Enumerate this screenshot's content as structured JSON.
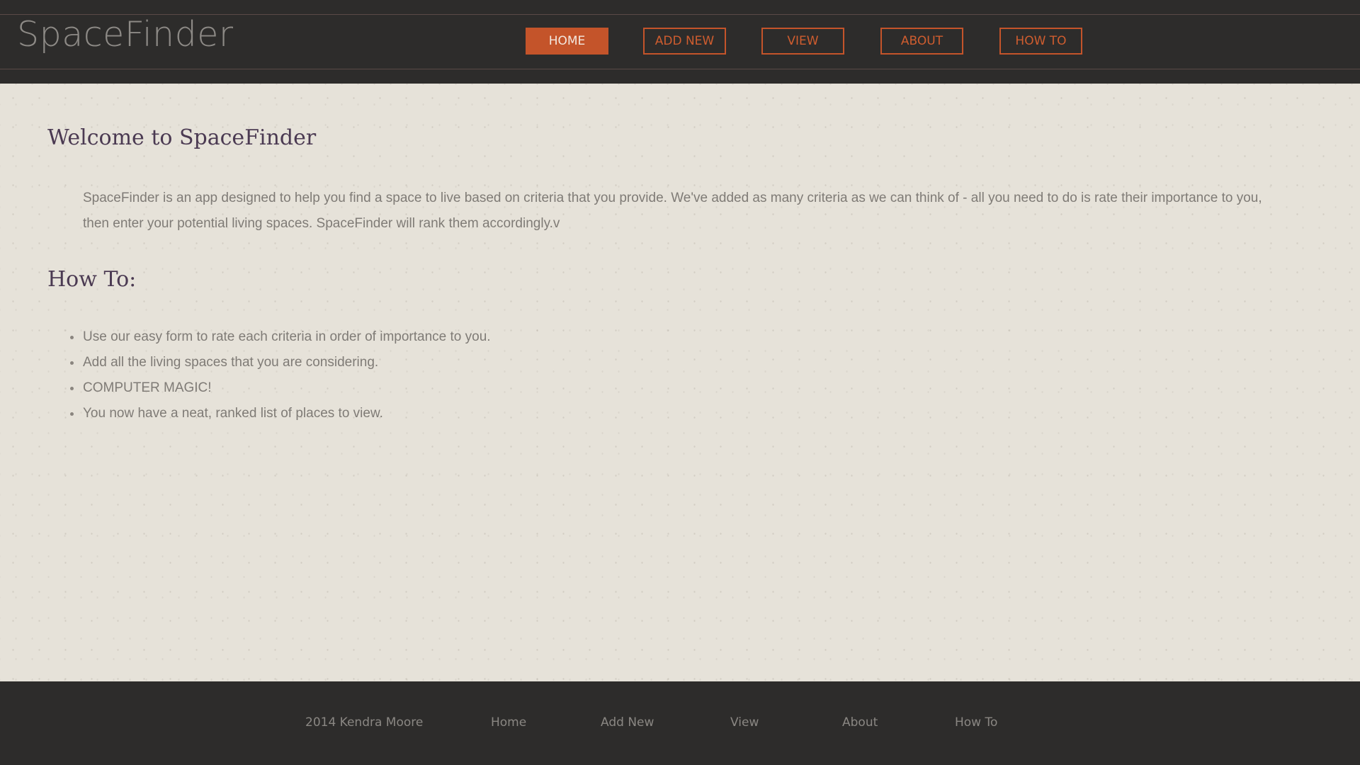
{
  "header": {
    "logo": "SpaceFinder",
    "nav": [
      {
        "label": "HOME",
        "active": true
      },
      {
        "label": "ADD NEW",
        "active": false
      },
      {
        "label": "VIEW",
        "active": false
      },
      {
        "label": "ABOUT",
        "active": false
      },
      {
        "label": "HOW TO",
        "active": false
      }
    ]
  },
  "main": {
    "welcome_title": "Welcome to SpaceFinder",
    "intro_line1": "SpaceFinder is an app designed to help you find a space to live based on criteria that you provide.  We've added as many criteria as we can think of - all you need to do is rate their importance to you,",
    "intro_line2": "then enter your potential living spaces.  SpaceFinder will rank them accordingly.v",
    "howto_title": "How To:",
    "steps": [
      "Use our easy form to rate each criteria in order of importance to you.",
      "Add all the living spaces that you are considering.",
      "COMPUTER MAGIC!",
      "You now have a neat, ranked list of places to view."
    ]
  },
  "footer": {
    "copyright": "2014 Kendra Moore",
    "links": [
      "Home",
      "Add New",
      "View",
      "About",
      "How To"
    ]
  },
  "colors": {
    "accent": "#c4542a",
    "dark_bar": "#2d2c2b",
    "content_bg": "#e6e2d9",
    "heading": "#4b3a52"
  }
}
